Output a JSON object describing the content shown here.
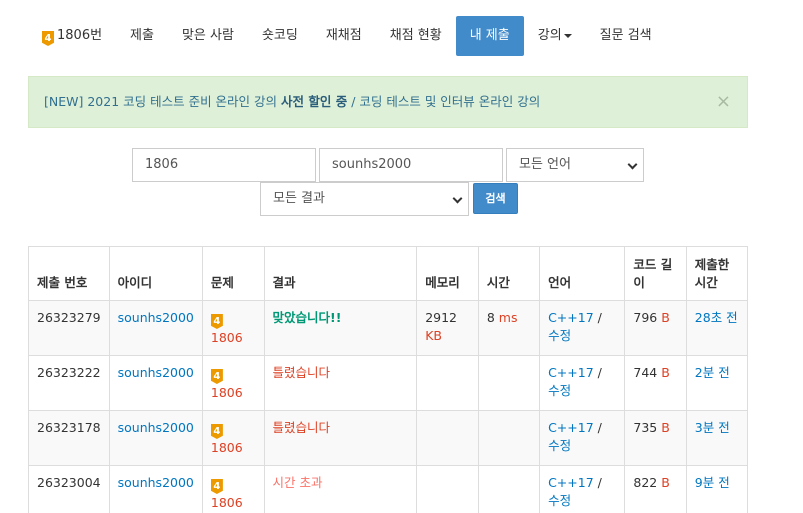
{
  "nav": {
    "problem_badge": "4",
    "items": [
      {
        "id": "problem",
        "label": "1806번"
      },
      {
        "id": "submit",
        "label": "제출"
      },
      {
        "id": "solvers",
        "label": "맞은 사람"
      },
      {
        "id": "shortcoding",
        "label": "숏코딩"
      },
      {
        "id": "rejudge",
        "label": "재채점"
      },
      {
        "id": "status",
        "label": "채점 현황"
      },
      {
        "id": "mysubmit",
        "label": "내 제출"
      },
      {
        "id": "lecture",
        "label": "강의"
      },
      {
        "id": "qna",
        "label": "질문 검색"
      }
    ]
  },
  "alert": {
    "part1": "[NEW] 2021 코딩 테스트 준비 온라인 강의",
    "bold": "사전 할인 중",
    "part2": "/ 코딩 테스트 및 인터뷰 온라인 강의",
    "close": "×"
  },
  "search": {
    "problem_id": "1806",
    "user_id": "sounhs2000",
    "language": "모든 언어",
    "result": "모든 결과",
    "button": "검색"
  },
  "table": {
    "headers": [
      "제출 번호",
      "아이디",
      "문제",
      "결과",
      "메모리",
      "시간",
      "언어",
      "코드 길이",
      "제출한 시간"
    ],
    "rows": [
      {
        "id": "26323279",
        "user": "sounhs2000",
        "badge": "4",
        "problem": "1806",
        "result": "맞았습니다!!",
        "memory": "2912",
        "memory_unit": "KB",
        "time": "8",
        "time_unit": "ms",
        "lang": "C++17",
        "sep": "/",
        "edit": "수정",
        "len": "796",
        "len_unit": "B",
        "submitted": "28초 전"
      },
      {
        "id": "26323222",
        "user": "sounhs2000",
        "badge": "4",
        "problem": "1806",
        "result": "틀렸습니다",
        "memory": "",
        "memory_unit": "",
        "time": "",
        "time_unit": "",
        "lang": "C++17",
        "sep": "/",
        "edit": "수정",
        "len": "744",
        "len_unit": "B",
        "submitted": "2분 전"
      },
      {
        "id": "26323178",
        "user": "sounhs2000",
        "badge": "4",
        "problem": "1806",
        "result": "틀렸습니다",
        "memory": "",
        "memory_unit": "",
        "time": "",
        "time_unit": "",
        "lang": "C++17",
        "sep": "/",
        "edit": "수정",
        "len": "735",
        "len_unit": "B",
        "submitted": "3분 전"
      },
      {
        "id": "26323004",
        "user": "sounhs2000",
        "badge": "4",
        "problem": "1806",
        "result": "시간 초과",
        "memory": "",
        "memory_unit": "",
        "time": "",
        "time_unit": "",
        "lang": "C++17",
        "sep": "/",
        "edit": "수정",
        "len": "822",
        "len_unit": "B",
        "submitted": "9분 전"
      }
    ]
  },
  "colors": {
    "accent": "#428bca",
    "link": "#0076c0",
    "accepted": "#009874",
    "wrong": "#dd4124",
    "tle": "#fa7268",
    "alert_bg": "#dff0d8"
  }
}
